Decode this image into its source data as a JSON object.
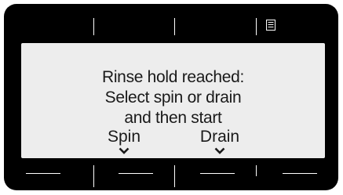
{
  "display": {
    "message_lines": [
      "Rinse hold reached:",
      "Select spin or drain",
      "and then start"
    ],
    "options": [
      {
        "label": "Spin",
        "icon": "chevron-down-icon"
      },
      {
        "label": "Drain",
        "icon": "chevron-down-icon"
      }
    ]
  },
  "top_bar": {
    "icon": "menu-list-icon"
  },
  "colors": {
    "bezel": "#000000",
    "screen": "#ededed",
    "text": "#1a1a1a",
    "lines": "#ffffff"
  }
}
